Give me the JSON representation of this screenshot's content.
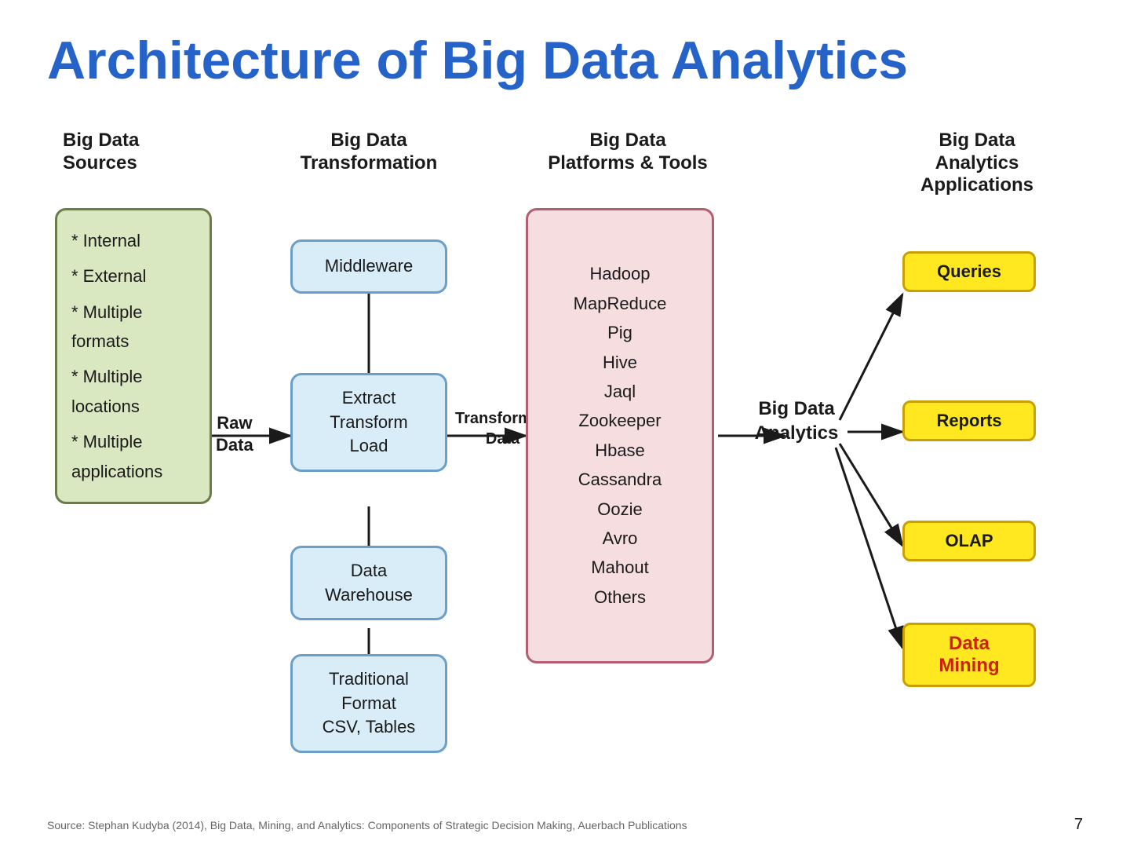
{
  "title": "Architecture of Big Data Analytics",
  "columns": {
    "sources": {
      "header": "Big Data\nSources",
      "items": [
        "* Internal",
        "* External",
        "* Multiple\nformats",
        "* Multiple\nlocations",
        "* Multiple\napplications"
      ]
    },
    "transform": {
      "header": "Big Data\nTransformation",
      "raw_label": "Raw\nData",
      "transformed_label": "Transformed\nData",
      "boxes": [
        "Middleware",
        "Extract\nTransform\nLoad",
        "Data\nWarehouse",
        "Traditional\nFormat\nCSV, Tables"
      ]
    },
    "platforms": {
      "header": "Big Data\nPlatforms & Tools",
      "items": [
        "Hadoop",
        "MapReduce",
        "Pig",
        "Hive",
        "Jaql",
        "Zookeeper",
        "Hbase",
        "Cassandra",
        "Oozie",
        "Avro",
        "Mahout",
        "Others"
      ]
    },
    "analytics": {
      "label": "Big Data\nAnalytics"
    },
    "apps": {
      "header": "Big Data\nAnalytics\nApplications",
      "items": [
        "Queries",
        "Reports",
        "OLAP",
        "Data\nMining"
      ]
    }
  },
  "footer": {
    "source": "Source: Stephan Kudyba (2014), Big Data, Mining, and Analytics: Components of Strategic Decision Making, Auerbach Publications",
    "page": "7"
  }
}
